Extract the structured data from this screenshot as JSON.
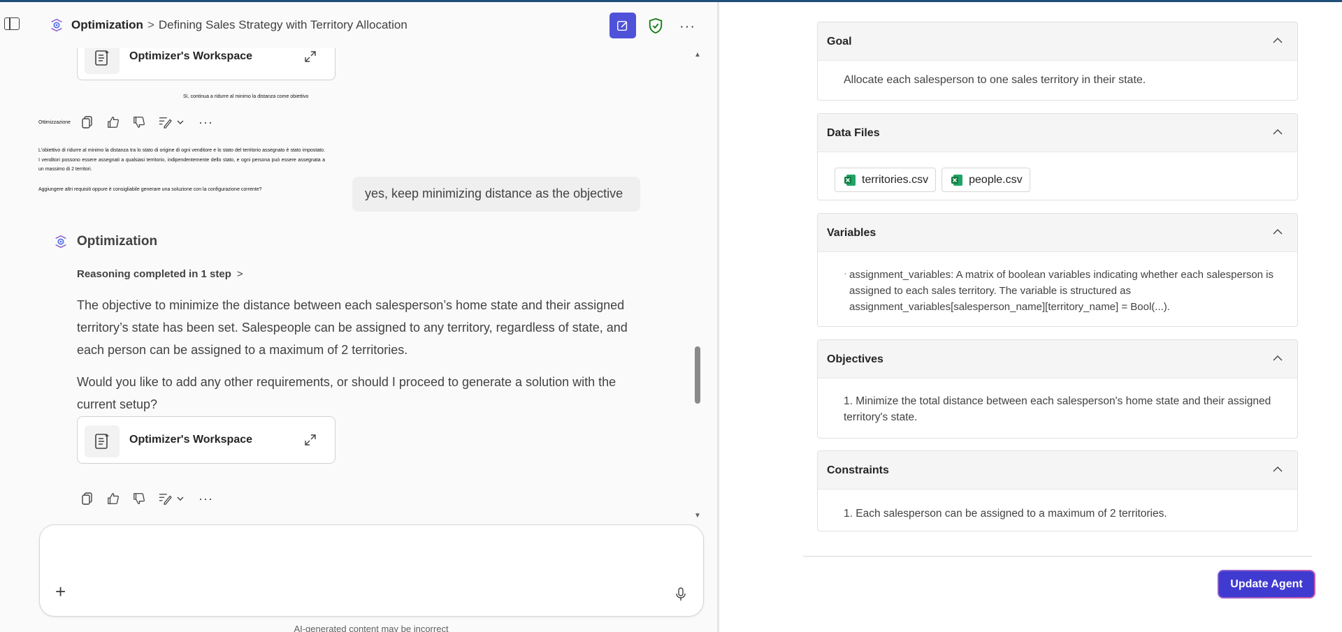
{
  "header": {
    "agent_name": "Optimization",
    "separator": ">",
    "conversation_title": "Defining Sales Strategy with Territory Allocation"
  },
  "chat": {
    "workspace_label": "Optimizer's Workspace",
    "prior_user_text_small": "Sì, continua a ridurre al minimo la distanza come obiettivo",
    "prior_bot_name_small": "Ottimizzazione",
    "prior_bot_para1": "L'obiettivo di ridurre al minimo la distanza tra lo stato di origine di ogni venditore e lo stato del territorio assegnato è stato impostato. I venditori possono essere assegnati a qualsiasi territorio, indipendentemente dello stato, e ogni persona può essere assegnata a un massimo di 2 territori.",
    "prior_bot_para2": "Aggiungere altri requisiti oppure è consigliabile generare una soluzione con la configurazione corrente?",
    "user_message": "yes, keep minimizing distance as the objective",
    "bot_name": "Optimization",
    "reasoning": "Reasoning completed in 1 step",
    "reasoning_chevron": ">",
    "response_p1": "The objective to minimize the distance between each salesperson’s home state and their assigned territory’s state has been set. Salespeople can be assigned to any territory, regardless of state, and each person can be assigned to a maximum of 2 territories.",
    "response_p2": "Would you like to add any other requirements, or should I proceed to generate a solution with the current setup?",
    "more": "···"
  },
  "composer": {
    "placeholder": "",
    "disclaimer": "AI-generated content may be incorrect"
  },
  "panel": {
    "goal": {
      "title": "Goal",
      "text": "Allocate each salesperson to one sales territory in their state."
    },
    "data_files": {
      "title": "Data Files",
      "files": [
        "territories.csv",
        "people.csv"
      ]
    },
    "variables": {
      "title": "Variables",
      "bullet": "·",
      "text": "assignment_variables: A matrix of boolean variables indicating whether each salesperson is assigned to each sales territory. The variable is structured as assignment_variables[salesperson_name][territory_name] = Bool(...)."
    },
    "objectives": {
      "title": "Objectives",
      "text": "1. Minimize the total distance between each salesperson's home state and their assigned territory's state."
    },
    "constraints": {
      "title": "Constraints",
      "text": "1. Each salesperson can be assigned to a maximum of 2 territories."
    },
    "update_button": "Update Agent"
  },
  "colors": {
    "accent": "#4f52d9",
    "shield": "#107c10",
    "excel": "#107c41"
  }
}
